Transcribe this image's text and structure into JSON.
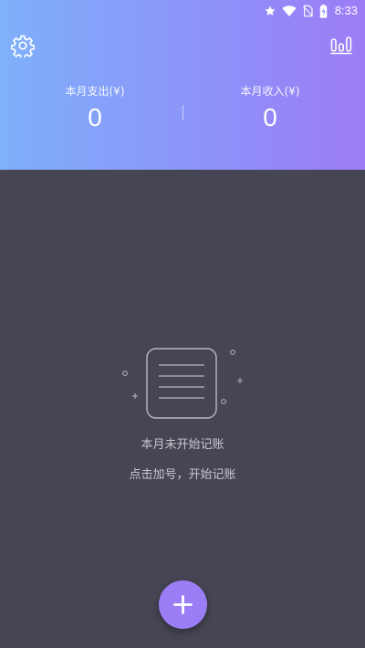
{
  "status_bar": {
    "time": "8:33",
    "icons": [
      "star-icon",
      "wifi-icon",
      "no-sim-icon",
      "battery-charging-icon"
    ]
  },
  "header": {
    "settings_icon": "gear-icon",
    "stats_icon": "bar-chart-icon",
    "expense": {
      "label": "本月支出(¥)",
      "value": "0"
    },
    "income": {
      "label": "本月收入(¥)",
      "value": "0"
    }
  },
  "empty_state": {
    "icon": "notebook-icon",
    "title": "本月未开始记账",
    "hint": "点击加号，开始记账"
  },
  "fab": {
    "icon": "plus-icon"
  },
  "colors": {
    "gradient_start": "#7fb0fb",
    "gradient_end": "#9d7cf6",
    "background": "#454553",
    "accent": "#9b7ef5",
    "muted_text": "#c8c8d0"
  }
}
